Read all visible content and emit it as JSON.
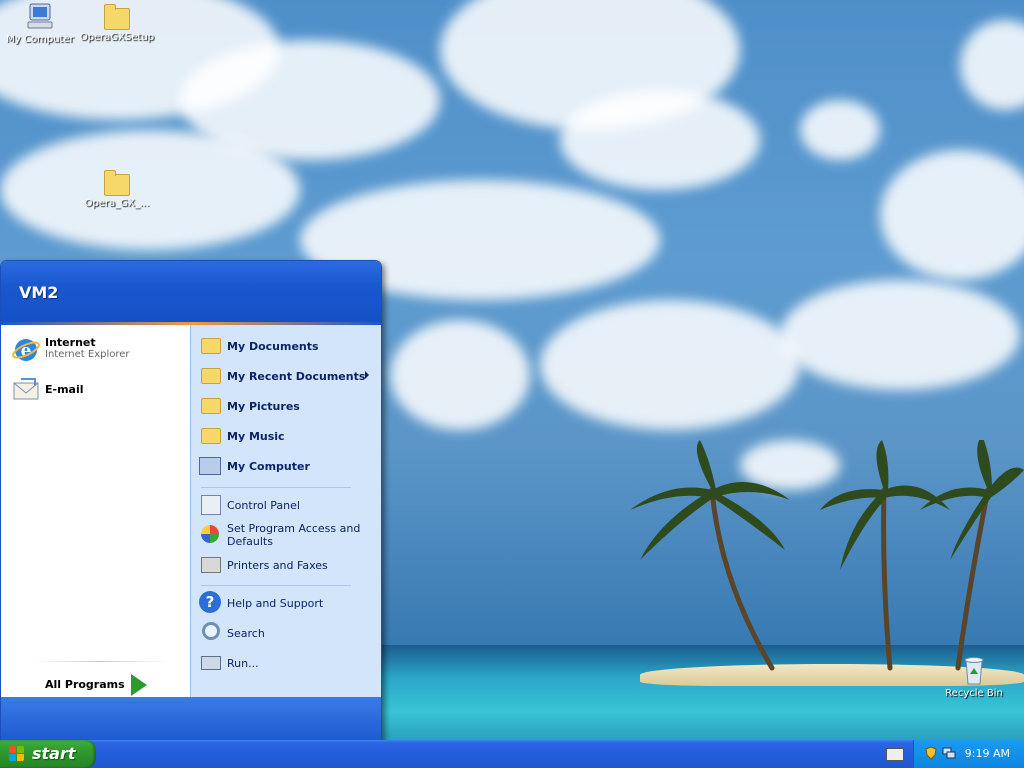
{
  "desktop": {
    "icons": [
      {
        "label": "My Computer",
        "icon": "my-computer-icon"
      },
      {
        "label": "OperaGXSetup",
        "icon": "folder-icon"
      },
      {
        "label": "Opera_GX_...",
        "icon": "folder-icon"
      },
      {
        "label": "Recycle Bin",
        "icon": "recycle-bin-icon"
      }
    ]
  },
  "start_menu": {
    "user_name": "VM2",
    "pinned": [
      {
        "title": "Internet",
        "subtitle": "Internet Explorer",
        "icon": "internet-explorer-icon"
      },
      {
        "title": "E-mail",
        "icon": "email-icon"
      }
    ],
    "all_programs_label": "All Programs",
    "places": [
      {
        "label": "My Documents",
        "icon": "my-documents-icon"
      },
      {
        "label": "My Recent Documents",
        "icon": "recent-documents-icon"
      },
      {
        "label": "My Pictures",
        "icon": "my-pictures-icon"
      },
      {
        "label": "My Music",
        "icon": "my-music-icon"
      },
      {
        "label": "My Computer",
        "icon": "my-computer-icon"
      }
    ],
    "system": [
      {
        "label": "Control Panel",
        "icon": "control-panel-icon"
      },
      {
        "label": "Set Program Access and Defaults",
        "icon": "program-access-icon"
      },
      {
        "label": "Printers and Faxes",
        "icon": "printer-icon"
      }
    ],
    "tools": [
      {
        "label": "Help and Support",
        "icon": "help-icon"
      },
      {
        "label": "Search",
        "icon": "search-icon"
      },
      {
        "label": "Run...",
        "icon": "run-icon"
      }
    ]
  },
  "taskbar": {
    "start_label": "start",
    "clock": "9:19 AM"
  },
  "colors": {
    "taskbar_blue": "#245ddb",
    "start_green": "#2f9a2f",
    "menu_header": "#1a57cf",
    "menu_right": "#d3e5fa"
  }
}
